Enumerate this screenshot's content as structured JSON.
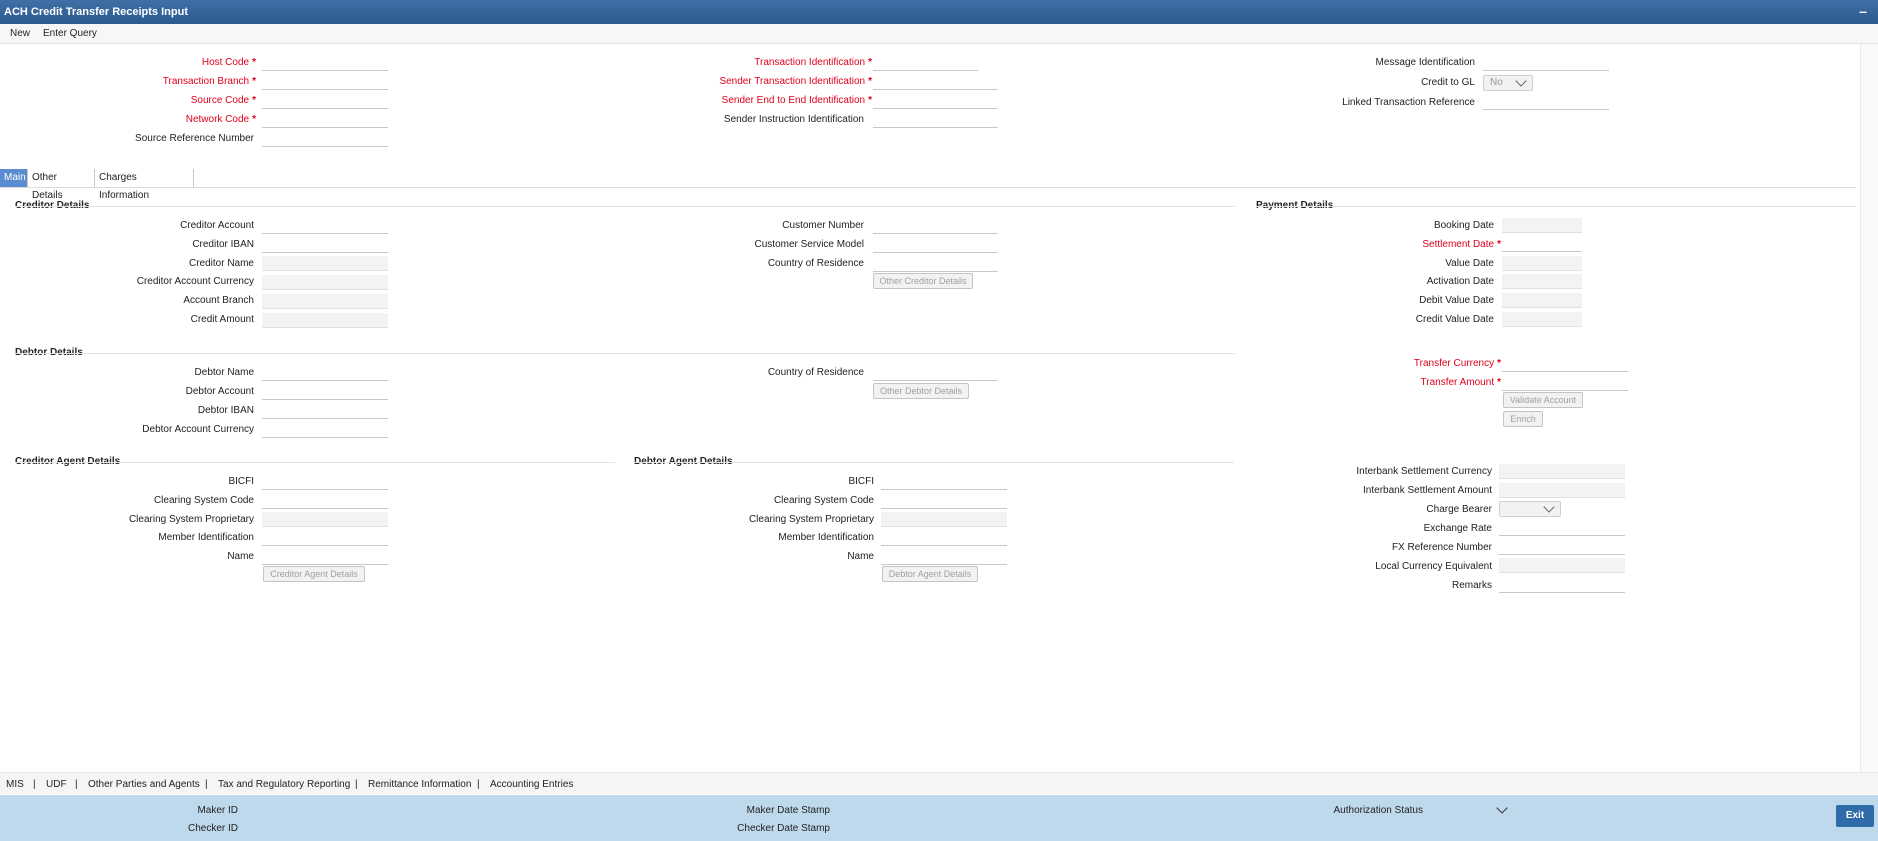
{
  "window": {
    "title": "ACH Credit Transfer Receipts Input"
  },
  "toolbar": {
    "new": "New",
    "enter_query": "Enter Query"
  },
  "header": {
    "host_code": "Host Code",
    "transaction_branch": "Transaction Branch",
    "source_code": "Source Code",
    "network_code": "Network Code",
    "source_reference_number": "Source Reference Number",
    "transaction_identification": "Transaction Identification",
    "sender_transaction_identification": "Sender Transaction Identification",
    "sender_end_to_end_identification": "Sender End to End Identification",
    "sender_instruction_identification": "Sender Instruction Identification",
    "message_identification": "Message Identification",
    "credit_to_gl": "Credit to GL",
    "credit_to_gl_value": "No",
    "linked_transaction_reference": "Linked Transaction Reference",
    "required_mark": "*"
  },
  "tabs": [
    "Main",
    "Other Details",
    "Charges Information"
  ],
  "creditor": {
    "title": "Creditor Details",
    "creditor_account": "Creditor Account",
    "creditor_iban": "Creditor IBAN",
    "creditor_name": "Creditor Name",
    "creditor_account_currency": "Creditor Account Currency",
    "account_branch": "Account Branch",
    "credit_amount": "Credit Amount",
    "customer_number": "Customer Number",
    "customer_service_model": "Customer Service Model",
    "country_of_residence": "Country of Residence",
    "other_creditor_details": "Other Creditor Details"
  },
  "debtor": {
    "title": "Debtor Details",
    "debtor_name": "Debtor Name",
    "debtor_account": "Debtor Account",
    "debtor_iban": "Debtor IBAN",
    "debtor_account_currency": "Debtor Account Currency",
    "country_of_residence": "Country of Residence",
    "other_debtor_details": "Other Debtor Details"
  },
  "creditor_agent": {
    "title": "Creditor Agent Details",
    "bicfi": "BICFI",
    "clearing_system_code": "Clearing System Code",
    "clearing_system_proprietary": "Clearing System Proprietary",
    "member_identification": "Member Identification",
    "name": "Name",
    "button": "Creditor Agent Details"
  },
  "debtor_agent": {
    "title": "Debtor Agent Details",
    "bicfi": "BICFI",
    "clearing_system_code": "Clearing System Code",
    "clearing_system_proprietary": "Clearing System Proprietary",
    "member_identification": "Member Identification",
    "name": "Name",
    "button": "Debtor Agent Details"
  },
  "payment": {
    "title": "Payment Details",
    "booking_date": "Booking Date",
    "settlement_date": "Settlement Date",
    "value_date": "Value Date",
    "activation_date": "Activation Date",
    "debit_value_date": "Debit Value Date",
    "credit_value_date": "Credit Value Date",
    "transfer_currency": "Transfer Currency",
    "transfer_amount": "Transfer Amount",
    "validate_account": "Validate Account",
    "enrich": "Enrich",
    "interbank_settlement_currency": "Interbank Settlement Currency",
    "interbank_settlement_amount": "Interbank Settlement Amount",
    "charge_bearer": "Charge Bearer",
    "exchange_rate": "Exchange Rate",
    "fx_reference_number": "FX Reference Number",
    "local_currency_equivalent": "Local Currency Equivalent",
    "remarks": "Remarks"
  },
  "bottom_nav": [
    "MIS",
    "UDF",
    "Other Parties and Agents",
    "Tax and Regulatory Reporting",
    "Remittance Information",
    "Accounting Entries"
  ],
  "bottom_sep": "|",
  "audit": {
    "maker_id": "Maker ID",
    "checker_id": "Checker ID",
    "maker_date_stamp": "Maker Date Stamp",
    "checker_date_stamp": "Checker Date Stamp",
    "authorization_status": "Authorization Status",
    "exit": "Exit"
  },
  "icons": {
    "minimize": "minimize-icon",
    "chevron": "chevron-down-icon"
  },
  "colors": {
    "title_bar": "#2b5a8f",
    "required": "#e0001b",
    "active_tab": "#5b8bd0",
    "audit_bar": "#bfd9ec",
    "exit_button": "#2e6ba8"
  }
}
